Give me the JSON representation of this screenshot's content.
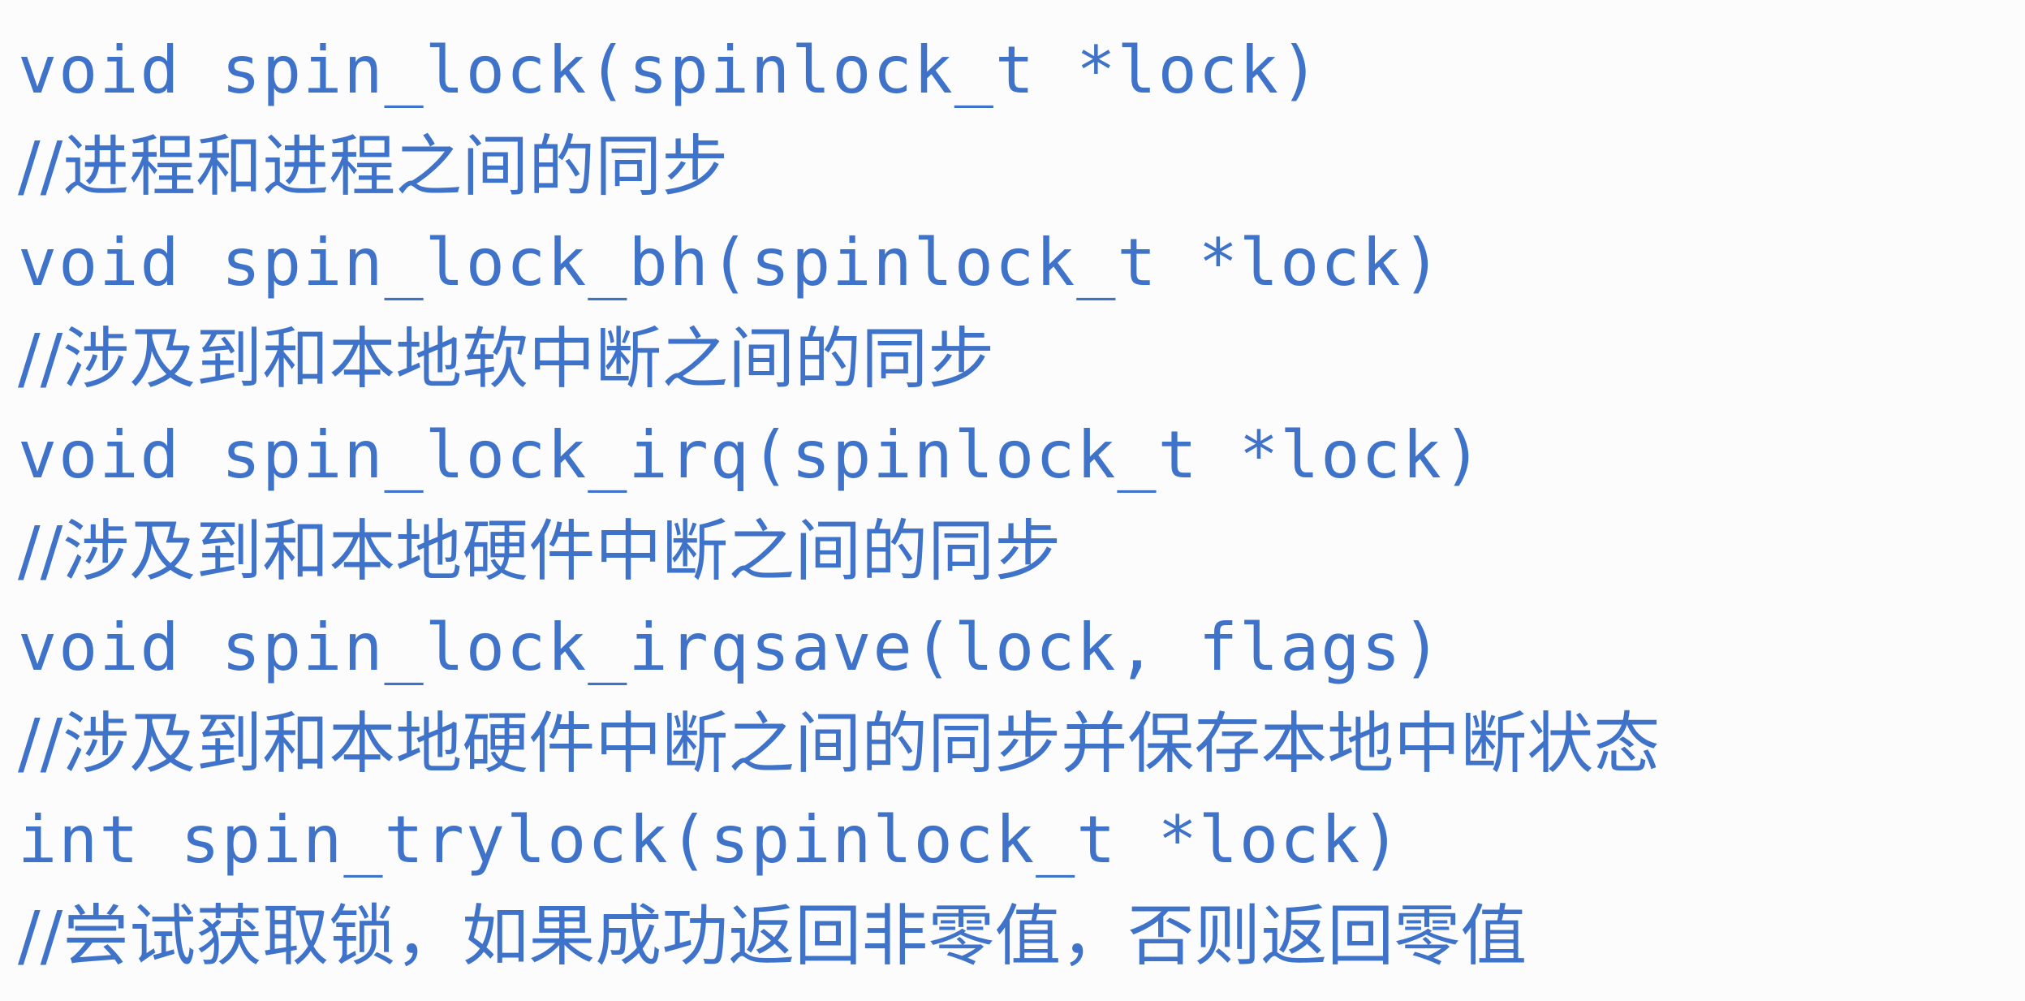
{
  "lines": [
    {
      "kind": "code",
      "text": "void spin_lock(spinlock_t *lock)"
    },
    {
      "kind": "comment",
      "text": "//进程和进程之间的同步"
    },
    {
      "kind": "code",
      "text": "void spin_lock_bh(spinlock_t *lock)"
    },
    {
      "kind": "comment",
      "text": "//涉及到和本地软中断之间的同步"
    },
    {
      "kind": "code",
      "text": "void spin_lock_irq(spinlock_t *lock)"
    },
    {
      "kind": "comment",
      "text": "//涉及到和本地硬件中断之间的同步"
    },
    {
      "kind": "code",
      "text": "void spin_lock_irqsave(lock, flags)"
    },
    {
      "kind": "comment",
      "text": "//涉及到和本地硬件中断之间的同步并保存本地中断状态"
    },
    {
      "kind": "code",
      "text": "int spin_trylock(spinlock_t *lock)"
    },
    {
      "kind": "comment",
      "text": "//尝试获取锁，如果成功返回非零值，否则返回零值"
    }
  ],
  "colors": {
    "text": "#3f72c9",
    "background": "#fcfcfc"
  }
}
